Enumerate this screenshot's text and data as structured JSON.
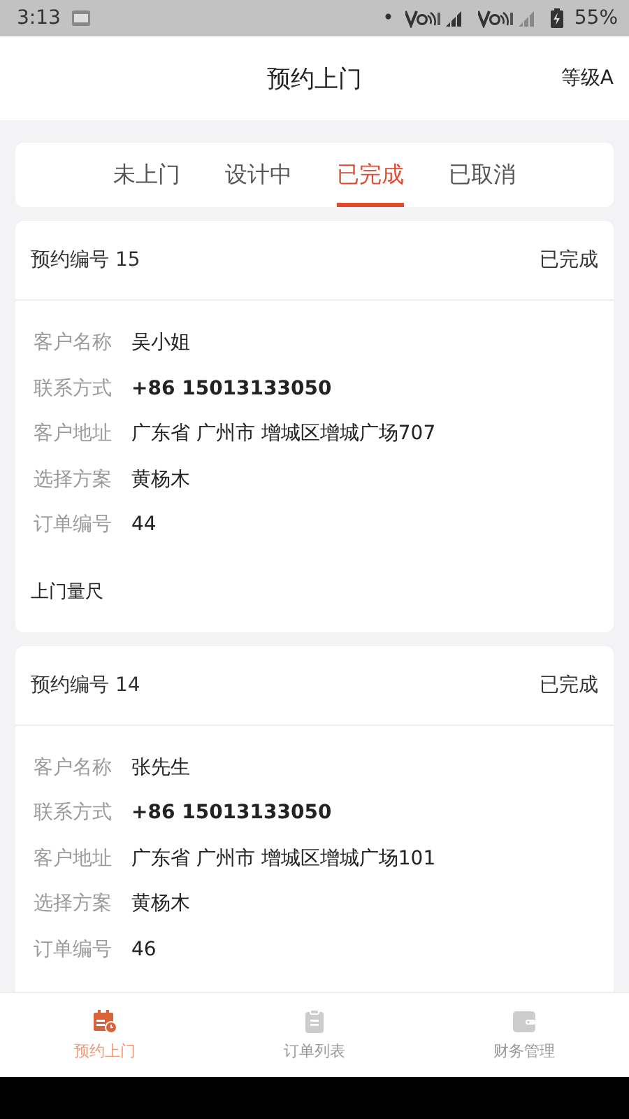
{
  "status_bar": {
    "time": "3:13",
    "dot": "•",
    "battery": "55%"
  },
  "header": {
    "title": "预约上门",
    "action": "等级A"
  },
  "tabs": [
    {
      "label": "未上门",
      "selected": false
    },
    {
      "label": "设计中",
      "selected": false
    },
    {
      "label": "已完成",
      "selected": true
    },
    {
      "label": "已取消",
      "selected": false
    }
  ],
  "appointments": [
    {
      "number": "预约编号 15",
      "status": "已完成",
      "fields": [
        {
          "label": "客户名称",
          "value": "吴小姐",
          "emphasis": false
        },
        {
          "label": "联系方式",
          "value": "+86 15013133050",
          "emphasis": true
        },
        {
          "label": "客户地址",
          "value": "广东省 广州市 增城区增城广场707",
          "emphasis": false
        },
        {
          "label": "选择方案",
          "value": "黄杨木",
          "emphasis": false
        },
        {
          "label": "订单编号",
          "value": "44",
          "emphasis": false
        }
      ],
      "footer": "上门量尺"
    },
    {
      "number": "预约编号 14",
      "status": "已完成",
      "fields": [
        {
          "label": "客户名称",
          "value": "张先生",
          "emphasis": false
        },
        {
          "label": "联系方式",
          "value": "+86 15013133050",
          "emphasis": true
        },
        {
          "label": "客户地址",
          "value": "广东省 广州市 增城区增城广场101",
          "emphasis": false
        },
        {
          "label": "选择方案",
          "value": "黄杨木",
          "emphasis": false
        },
        {
          "label": "订单编号",
          "value": "46",
          "emphasis": false
        }
      ]
    }
  ],
  "nav": [
    {
      "label": "预约上门",
      "kind": "calendar",
      "selected": true
    },
    {
      "label": "订单列表",
      "kind": "clipboard",
      "selected": false
    },
    {
      "label": "财务管理",
      "kind": "wallet",
      "selected": false
    }
  ]
}
